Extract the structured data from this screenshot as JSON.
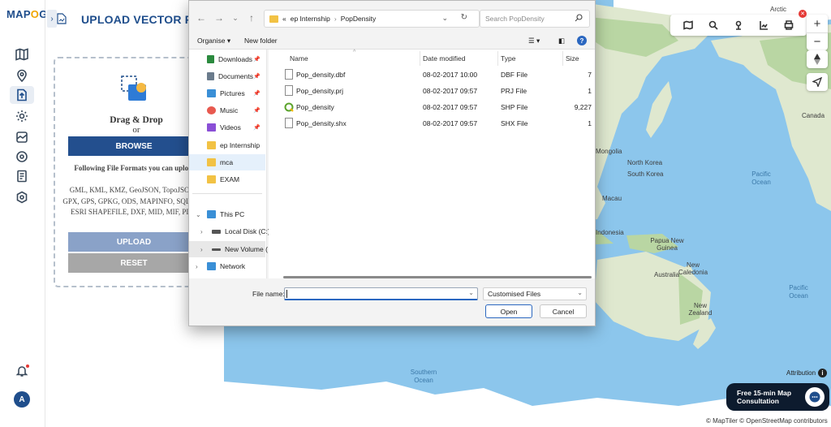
{
  "app": {
    "logo_text_1": "MAP",
    "logo_text_2": "O",
    "logo_text_3": "G",
    "panel_title": "UPLOAD VECTOR FILE",
    "user_initial": "A"
  },
  "upload": {
    "drag_drop": "Drag & Drop",
    "or": "or",
    "browse_label": "BROWSE",
    "formats_heading": "Following File Formats you can upload:",
    "formats_list": "GML, KML, KMZ, GeoJSON, TopoJSON, GPX, GPS, GPKG, ODS, MAPINFO, SQLITE, ESRI SHAPEFILE, DXF, MID, MIF, PDF",
    "upload_label": "UPLOAD",
    "reset_label": "RESET"
  },
  "dialog": {
    "breadcrumb": [
      "«",
      "ep Internship",
      "PopDensity"
    ],
    "search_placeholder": "Search PopDensity",
    "organise_label": "Organise ▾",
    "new_folder_label": "New folder",
    "nav_items": [
      {
        "label": "Downloads",
        "pinned": true,
        "icon": "download-icon",
        "color": "#2b8a3e"
      },
      {
        "label": "Documents",
        "pinned": true,
        "icon": "documents-icon",
        "color": "#6a7b8c"
      },
      {
        "label": "Pictures",
        "pinned": true,
        "icon": "pictures-icon",
        "color": "#3a8fd6"
      },
      {
        "label": "Music",
        "pinned": true,
        "icon": "music-icon",
        "color": "#e8594f"
      },
      {
        "label": "Videos",
        "pinned": true,
        "icon": "videos-icon",
        "color": "#8a4fd6"
      },
      {
        "label": "ep Internship",
        "pinned": false,
        "icon": "folder-icon",
        "color": "#f2c244"
      },
      {
        "label": "mca",
        "pinned": false,
        "icon": "folder-icon",
        "color": "#f2c244",
        "selected": true
      },
      {
        "label": "EXAM",
        "pinned": false,
        "icon": "folder-icon",
        "color": "#f2c244"
      }
    ],
    "tree_items": [
      {
        "label": "This PC",
        "icon": "this-pc-icon",
        "color": "#3a8fd6",
        "expanded": true
      },
      {
        "label": "Local Disk (C:)",
        "icon": "drive-icon",
        "color": "#555555",
        "expanded": false
      },
      {
        "label": "New Volume (",
        "icon": "drive-icon",
        "color": "#555555",
        "expanded": false,
        "selected": true
      },
      {
        "label": "Network",
        "icon": "network-icon",
        "color": "#3a8fd6",
        "expanded": false
      }
    ],
    "columns": {
      "name": "Name",
      "date": "Date modified",
      "type": "Type",
      "size": "Size"
    },
    "files": [
      {
        "name": "Pop_density.dbf",
        "date": "08-02-2017 10:00",
        "type": "DBF File",
        "size": "7",
        "icon": "file-icon"
      },
      {
        "name": "Pop_density.prj",
        "date": "08-02-2017 09:57",
        "type": "PRJ File",
        "size": "1",
        "icon": "file-icon"
      },
      {
        "name": "Pop_density",
        "date": "08-02-2017 09:57",
        "type": "SHP File",
        "size": "9,227",
        "icon": "qgis-icon"
      },
      {
        "name": "Pop_density.shx",
        "date": "08-02-2017 09:57",
        "type": "SHX File",
        "size": "1",
        "icon": "file-icon"
      }
    ],
    "file_name_label": "File name:",
    "file_name_value": "",
    "file_type_value": "Customised Files",
    "open_label": "Open",
    "cancel_label": "Cancel"
  },
  "map": {
    "labels": [
      "Arctic",
      "Canada",
      "Mongolia",
      "North Korea",
      "South Korea",
      "Macau",
      "Indonesia",
      "Papua New Guinea",
      "Australia",
      "New Caledonia",
      "New Zealand"
    ],
    "ocean_labels": [
      "Pacific Ocean",
      "Pacific Ocean",
      "Southern Ocean"
    ],
    "attribution_label": "Attribution",
    "consult_line1": "Free 15-min Map",
    "consult_line2": "Consultation",
    "copyright": "© MapTiler © OpenStreetMap contributors",
    "colors": {
      "ocean": "#8cc6ec",
      "land": "#dfe8cf",
      "forest": "#b9d6a3",
      "ice": "#ffffff"
    }
  }
}
